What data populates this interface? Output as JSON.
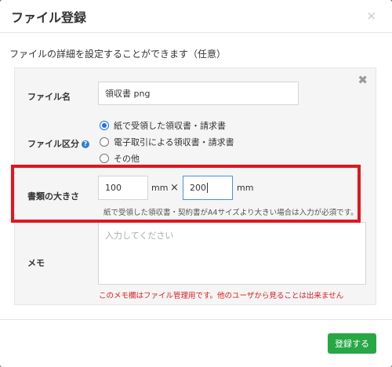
{
  "modal": {
    "title": "ファイル登録",
    "close_icon": "×",
    "intro": "ファイルの詳細を設定することができます（任意）"
  },
  "panel": {
    "close_icon": "✖"
  },
  "fields": {
    "file_name": {
      "label": "ファイル名",
      "value": "領収書 png"
    },
    "file_type": {
      "label": "ファイル区分",
      "help_icon": "?",
      "options": [
        {
          "label": "紙で受領した領収書・請求書",
          "checked": true
        },
        {
          "label": "電子取引による領収書・請求書",
          "checked": false
        },
        {
          "label": "その他",
          "checked": false
        }
      ]
    },
    "doc_size": {
      "label": "書類の大きさ",
      "width": "100",
      "height": "200",
      "unit": "mm",
      "times": "×",
      "note": "紙で受領した領収書・契約書がA4サイズより大きい場合は入力が必須です。"
    },
    "memo": {
      "label": "メモ",
      "placeholder": "入力してください",
      "warning": "このメモ欄はファイル管理用です。他のユーザから見ることは出来ません"
    }
  },
  "footer": {
    "submit_label": "登録する"
  },
  "colors": {
    "accent": "#1a73e8",
    "highlight": "#e3151e",
    "submit": "#28a745",
    "warning": "#e0191e"
  }
}
